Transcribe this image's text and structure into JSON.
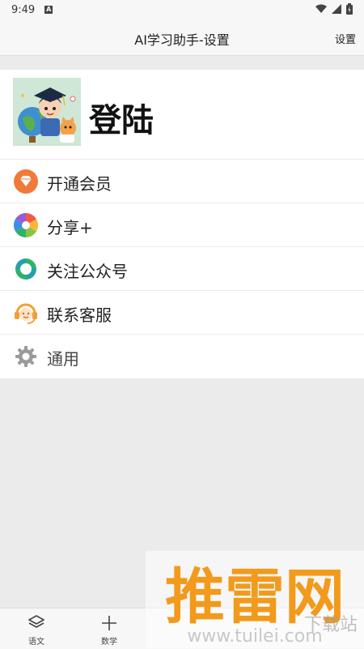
{
  "status_bar": {
    "time": "9:49",
    "notification_icon": "A"
  },
  "app_bar": {
    "title": "AI学习助手-设置",
    "action": "设置"
  },
  "profile": {
    "login_label": "登陆"
  },
  "menu": [
    {
      "label": "开通会员",
      "icon": "diamond-icon",
      "color": "#f07a3a"
    },
    {
      "label": "分享+",
      "icon": "share-icon",
      "color": "#3a8fe8"
    },
    {
      "label": "关注公众号",
      "icon": "wechat-mp-icon",
      "color": "#2fb36b"
    },
    {
      "label": "联系客服",
      "icon": "customer-service-icon",
      "color": "#f3a033"
    },
    {
      "label": "通用",
      "icon": "gear-icon",
      "color": "#9a9a9a"
    }
  ],
  "bottom_nav": [
    {
      "label": "语文",
      "icon": "layers-icon"
    },
    {
      "label": "数学",
      "icon": "plus-icon"
    }
  ],
  "watermark": {
    "brand": "推雷网",
    "url": "www.tuilei.com",
    "suffix": "下载站"
  }
}
